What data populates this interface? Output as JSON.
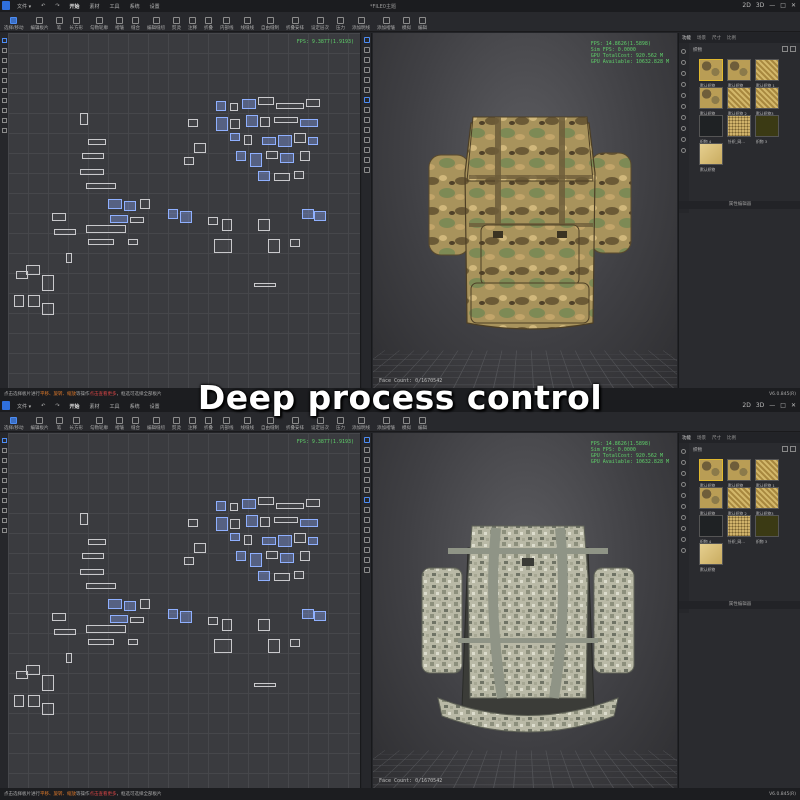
{
  "caption": "Deep process control",
  "menubar": {
    "items": [
      "文件 ▾",
      "↶",
      "↷",
      "开始",
      "素材",
      "工具",
      "系统",
      "设置"
    ],
    "window_title": "*FILE0主题",
    "window_controls": [
      "2D",
      "3D",
      "—",
      "□",
      "✕"
    ]
  },
  "toolbar": {
    "items": [
      "选择/移动",
      "编辑板片",
      "笔",
      "长方形",
      "勾勒轮廓",
      "褶皱",
      "缝合",
      "编辑缝纫",
      "熨烫",
      "注释",
      "折叠",
      "内部线",
      "线缝线",
      "自由缝制",
      "折叠安排",
      "设定层次",
      "压力",
      "添加明线",
      "添加褶皱",
      "模拟",
      "编辑"
    ]
  },
  "views": {
    "fps_2d": "FPS: 9.3877(1.9193)",
    "stats_3d": [
      "FPS: 14.8626(1.5898)",
      "Sim FPS: 0.0000",
      "GPU TotalCost: 920.562 M",
      "GPU Available: 10632.828 M"
    ],
    "face_count": "Face Count: 0/1670542"
  },
  "right_panel": {
    "tabs": [
      "功能",
      "场景",
      "尺寸",
      "比例"
    ],
    "fabric_title": "织物",
    "property_bar": "属性编辑器",
    "swatches": [
      {
        "label": "默认织物",
        "pattern": "camo"
      },
      {
        "label": "默认织物",
        "pattern": "camo"
      },
      {
        "label": "默认织物 1",
        "pattern": "gold"
      },
      {
        "label": "默认织物",
        "pattern": "camo"
      },
      {
        "label": "默认织物 2",
        "pattern": "gold"
      },
      {
        "label": "默认织物3",
        "pattern": "gold"
      },
      {
        "label": "织物 4",
        "pattern": "dark"
      },
      {
        "label": "针织_网...",
        "pattern": "dots"
      },
      {
        "label": "织物 3",
        "pattern": "olive"
      },
      {
        "label": "默认织物",
        "pattern": "pale"
      }
    ]
  },
  "statusbar": {
    "text1": "点击选择板片进行",
    "hl1": "平移、旋转、缩放",
    "text2": "等操作",
    "hl2": "点击查看更多",
    "text3": "，框选可选择全部板片",
    "version": "V6.0.845(R)"
  },
  "colors": {
    "accent": "#4d8df5",
    "fps_green": "#5fd06a",
    "selection": "#8fb0ff"
  },
  "backpacks": {
    "top": "multicam",
    "bottom": "acu-digital"
  }
}
